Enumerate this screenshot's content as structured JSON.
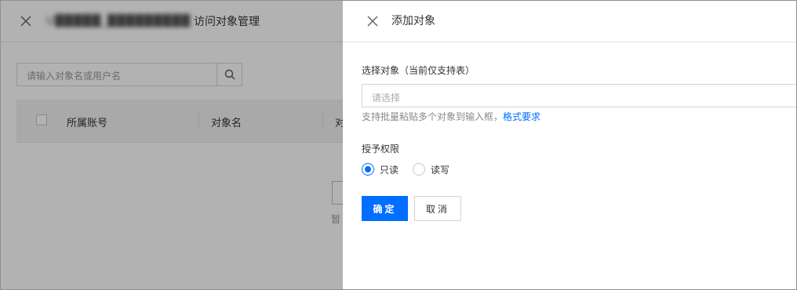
{
  "background_page": {
    "header": {
      "title_blurred": "U█████_█████████",
      "title": "访问对象管理"
    },
    "search": {
      "placeholder": "请输入对象名或用户名"
    },
    "table": {
      "columns": [
        "所属账号",
        "对象名",
        "对"
      ]
    },
    "empty_text": "暂"
  },
  "drawer": {
    "title": "添加对象",
    "object_field": {
      "label": "选择对象（当前仅支持表）",
      "placeholder": "请选择",
      "help_text": "支持批量粘贴多个对象到输入框，",
      "help_link": "格式要求"
    },
    "permission_field": {
      "label": "授予权限",
      "options": [
        {
          "label": "只读",
          "checked": true
        },
        {
          "label": "读写",
          "checked": false
        }
      ]
    },
    "buttons": {
      "confirm": "确定",
      "cancel": "取消"
    }
  },
  "colors": {
    "primary": "#006eff",
    "mask": "rgba(0,0,0,0.3)"
  }
}
